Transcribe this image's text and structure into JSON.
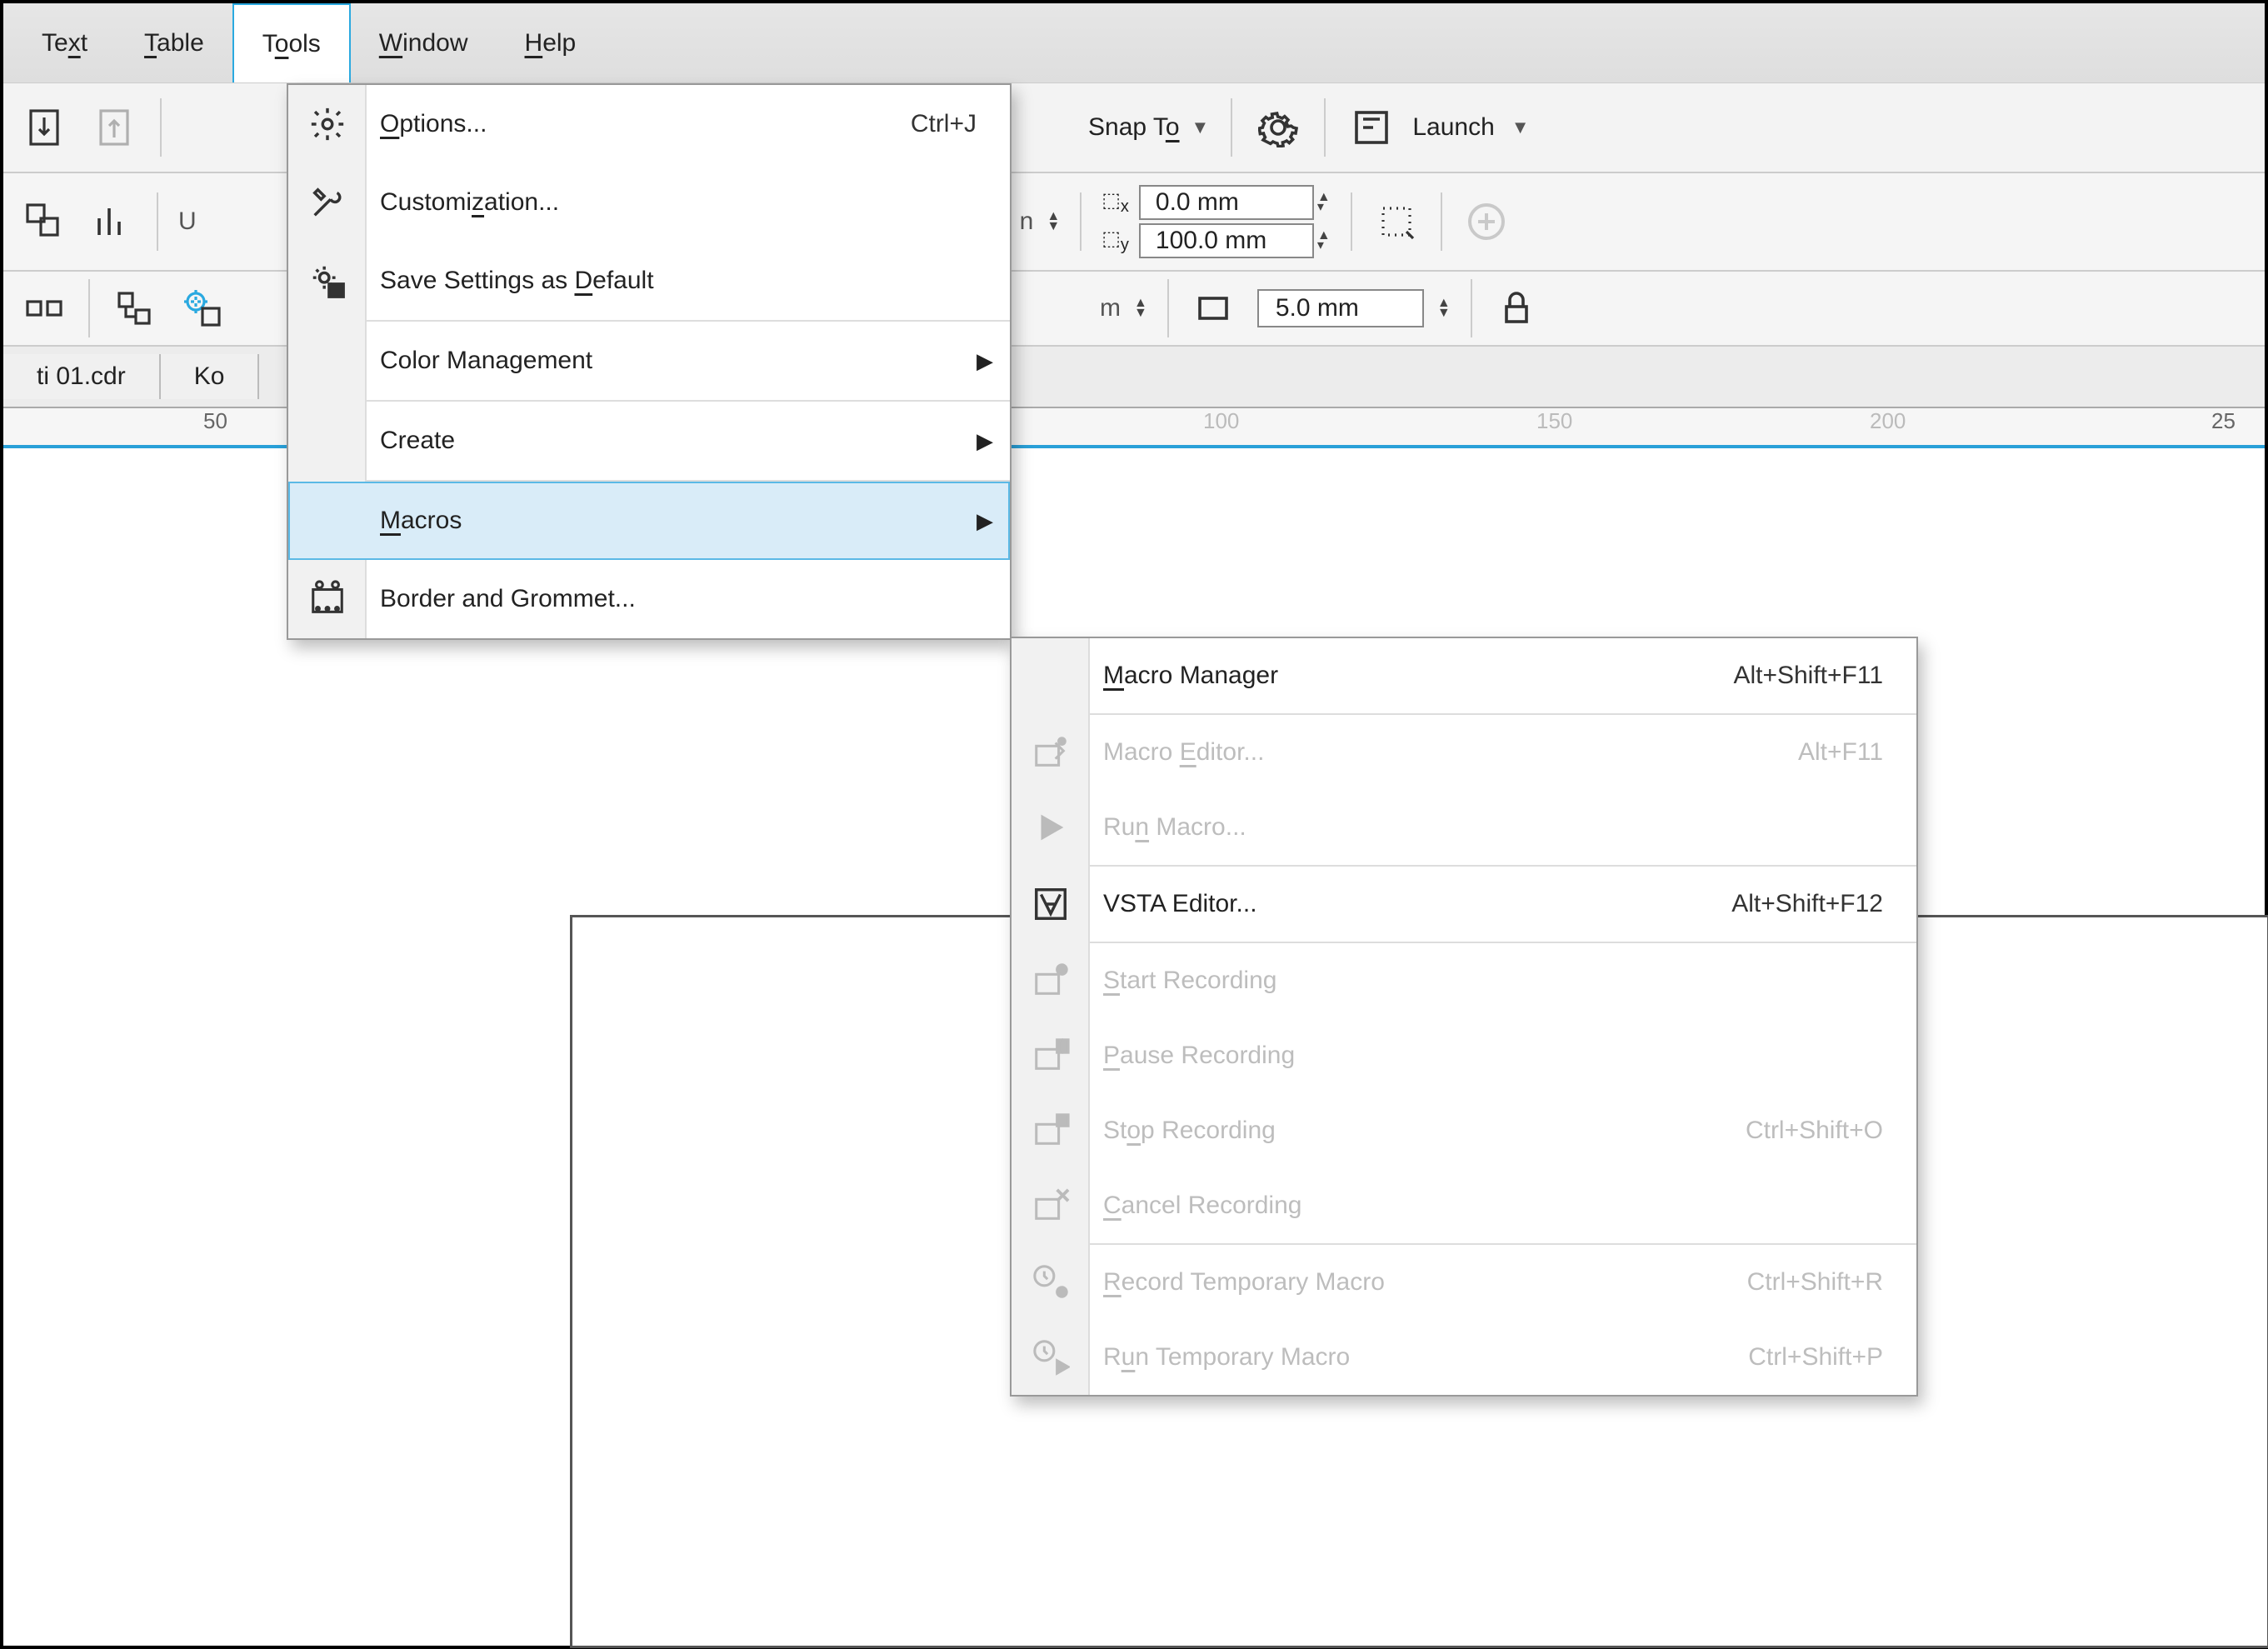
{
  "menubar": {
    "text": "Text",
    "table": "Table",
    "tools": "Tools",
    "window": "Window",
    "help": "Help"
  },
  "toolbar": {
    "snap_to": "Snap To",
    "launch": "Launch"
  },
  "coords": {
    "x": "0.0 mm",
    "y": "100.0 mm"
  },
  "toolbar3": {
    "m_label": "m",
    "gap_value": "5.0 mm"
  },
  "tabs": {
    "file1": "ti 01.cdr",
    "file2": "Ko"
  },
  "ruler": {
    "t50": "50",
    "t100": "100",
    "t150": "150",
    "t200": "200",
    "t250": "25"
  },
  "tools_menu": {
    "options": "Options...",
    "options_short": "Ctrl+J",
    "customization": "Customization...",
    "save_default": "Save Settings as Default",
    "color_mgmt": "Color Management",
    "create": "Create",
    "macros": "Macros",
    "border": "Border and Grommet..."
  },
  "macros_menu": {
    "manager": "Macro Manager",
    "manager_short": "Alt+Shift+F11",
    "editor": "Macro Editor...",
    "editor_short": "Alt+F11",
    "run": "Run Macro...",
    "vsta": "VSTA Editor...",
    "vsta_short": "Alt+Shift+F12",
    "start_rec": "Start Recording",
    "pause_rec": "Pause Recording",
    "stop_rec": "Stop Recording",
    "stop_rec_short": "Ctrl+Shift+O",
    "cancel_rec": "Cancel Recording",
    "rec_temp": "Record Temporary Macro",
    "rec_temp_short": "Ctrl+Shift+R",
    "run_temp": "Run Temporary Macro",
    "run_temp_short": "Ctrl+Shift+P"
  }
}
